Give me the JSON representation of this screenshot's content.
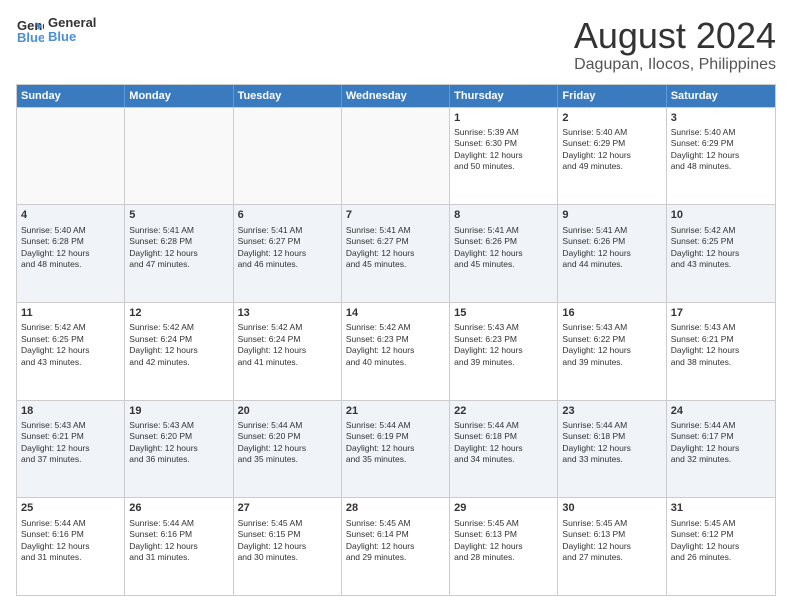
{
  "logo": {
    "line1": "General",
    "line2": "Blue"
  },
  "title": "August 2024",
  "subtitle": "Dagupan, Ilocos, Philippines",
  "header_days": [
    "Sunday",
    "Monday",
    "Tuesday",
    "Wednesday",
    "Thursday",
    "Friday",
    "Saturday"
  ],
  "weeks": [
    [
      {
        "day": "",
        "content": ""
      },
      {
        "day": "",
        "content": ""
      },
      {
        "day": "",
        "content": ""
      },
      {
        "day": "",
        "content": ""
      },
      {
        "day": "1",
        "content": "Sunrise: 5:39 AM\nSunset: 6:30 PM\nDaylight: 12 hours\nand 50 minutes."
      },
      {
        "day": "2",
        "content": "Sunrise: 5:40 AM\nSunset: 6:29 PM\nDaylight: 12 hours\nand 49 minutes."
      },
      {
        "day": "3",
        "content": "Sunrise: 5:40 AM\nSunset: 6:29 PM\nDaylight: 12 hours\nand 48 minutes."
      }
    ],
    [
      {
        "day": "4",
        "content": "Sunrise: 5:40 AM\nSunset: 6:28 PM\nDaylight: 12 hours\nand 48 minutes."
      },
      {
        "day": "5",
        "content": "Sunrise: 5:41 AM\nSunset: 6:28 PM\nDaylight: 12 hours\nand 47 minutes."
      },
      {
        "day": "6",
        "content": "Sunrise: 5:41 AM\nSunset: 6:27 PM\nDaylight: 12 hours\nand 46 minutes."
      },
      {
        "day": "7",
        "content": "Sunrise: 5:41 AM\nSunset: 6:27 PM\nDaylight: 12 hours\nand 45 minutes."
      },
      {
        "day": "8",
        "content": "Sunrise: 5:41 AM\nSunset: 6:26 PM\nDaylight: 12 hours\nand 45 minutes."
      },
      {
        "day": "9",
        "content": "Sunrise: 5:41 AM\nSunset: 6:26 PM\nDaylight: 12 hours\nand 44 minutes."
      },
      {
        "day": "10",
        "content": "Sunrise: 5:42 AM\nSunset: 6:25 PM\nDaylight: 12 hours\nand 43 minutes."
      }
    ],
    [
      {
        "day": "11",
        "content": "Sunrise: 5:42 AM\nSunset: 6:25 PM\nDaylight: 12 hours\nand 43 minutes."
      },
      {
        "day": "12",
        "content": "Sunrise: 5:42 AM\nSunset: 6:24 PM\nDaylight: 12 hours\nand 42 minutes."
      },
      {
        "day": "13",
        "content": "Sunrise: 5:42 AM\nSunset: 6:24 PM\nDaylight: 12 hours\nand 41 minutes."
      },
      {
        "day": "14",
        "content": "Sunrise: 5:42 AM\nSunset: 6:23 PM\nDaylight: 12 hours\nand 40 minutes."
      },
      {
        "day": "15",
        "content": "Sunrise: 5:43 AM\nSunset: 6:23 PM\nDaylight: 12 hours\nand 39 minutes."
      },
      {
        "day": "16",
        "content": "Sunrise: 5:43 AM\nSunset: 6:22 PM\nDaylight: 12 hours\nand 39 minutes."
      },
      {
        "day": "17",
        "content": "Sunrise: 5:43 AM\nSunset: 6:21 PM\nDaylight: 12 hours\nand 38 minutes."
      }
    ],
    [
      {
        "day": "18",
        "content": "Sunrise: 5:43 AM\nSunset: 6:21 PM\nDaylight: 12 hours\nand 37 minutes."
      },
      {
        "day": "19",
        "content": "Sunrise: 5:43 AM\nSunset: 6:20 PM\nDaylight: 12 hours\nand 36 minutes."
      },
      {
        "day": "20",
        "content": "Sunrise: 5:44 AM\nSunset: 6:20 PM\nDaylight: 12 hours\nand 35 minutes."
      },
      {
        "day": "21",
        "content": "Sunrise: 5:44 AM\nSunset: 6:19 PM\nDaylight: 12 hours\nand 35 minutes."
      },
      {
        "day": "22",
        "content": "Sunrise: 5:44 AM\nSunset: 6:18 PM\nDaylight: 12 hours\nand 34 minutes."
      },
      {
        "day": "23",
        "content": "Sunrise: 5:44 AM\nSunset: 6:18 PM\nDaylight: 12 hours\nand 33 minutes."
      },
      {
        "day": "24",
        "content": "Sunrise: 5:44 AM\nSunset: 6:17 PM\nDaylight: 12 hours\nand 32 minutes."
      }
    ],
    [
      {
        "day": "25",
        "content": "Sunrise: 5:44 AM\nSunset: 6:16 PM\nDaylight: 12 hours\nand 31 minutes."
      },
      {
        "day": "26",
        "content": "Sunrise: 5:44 AM\nSunset: 6:16 PM\nDaylight: 12 hours\nand 31 minutes."
      },
      {
        "day": "27",
        "content": "Sunrise: 5:45 AM\nSunset: 6:15 PM\nDaylight: 12 hours\nand 30 minutes."
      },
      {
        "day": "28",
        "content": "Sunrise: 5:45 AM\nSunset: 6:14 PM\nDaylight: 12 hours\nand 29 minutes."
      },
      {
        "day": "29",
        "content": "Sunrise: 5:45 AM\nSunset: 6:13 PM\nDaylight: 12 hours\nand 28 minutes."
      },
      {
        "day": "30",
        "content": "Sunrise: 5:45 AM\nSunset: 6:13 PM\nDaylight: 12 hours\nand 27 minutes."
      },
      {
        "day": "31",
        "content": "Sunrise: 5:45 AM\nSunset: 6:12 PM\nDaylight: 12 hours\nand 26 minutes."
      }
    ]
  ]
}
